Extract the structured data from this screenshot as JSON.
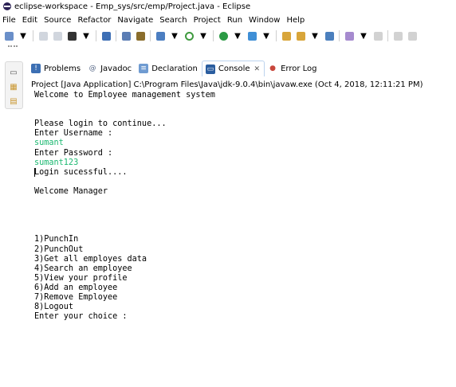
{
  "window": {
    "title": "eclipse-workspace - Emp_sys/src/emp/Project.java - Eclipse"
  },
  "menu": [
    "File",
    "Edit",
    "Source",
    "Refactor",
    "Navigate",
    "Search",
    "Project",
    "Run",
    "Window",
    "Help"
  ],
  "toolbar_icons": [
    {
      "name": "new-icon",
      "color": "#6a8fc9"
    },
    {
      "name": "save-icon",
      "color": "#9aa5b5"
    },
    {
      "name": "save-all-icon",
      "color": "#9aa5b5"
    },
    {
      "name": "console-icon",
      "color": "#333333"
    },
    {
      "name": "open-type-icon",
      "color": "#3e6fb5"
    },
    {
      "name": "toggle-breadcrumb-icon",
      "color": "#5b7db4"
    },
    {
      "name": "toggle-mark-occurrences-icon",
      "color": "#8a6d2c"
    },
    {
      "name": "skip-breakpoints-icon",
      "color": "#4c7ec1"
    },
    {
      "name": "debug-icon",
      "color": "#3f9a3f"
    },
    {
      "name": "run-icon",
      "color": "#2b9a44"
    },
    {
      "name": "run-external-tool-icon",
      "color": "#3f8fd6"
    },
    {
      "name": "new-java-project-icon",
      "color": "#d8a53a"
    },
    {
      "name": "new-package-icon",
      "color": "#d8a53a"
    },
    {
      "name": "new-class-icon",
      "color": "#4b7fbd"
    },
    {
      "name": "search-icon",
      "color": "#a68bcf"
    },
    {
      "name": "annotation-icon",
      "color": "#9c9c9c"
    },
    {
      "name": "show-whitespace-icon",
      "color": "#9c9c9c"
    },
    {
      "name": "pin-icon",
      "color": "#9c9c9c"
    }
  ],
  "left_strip": {
    "icons": [
      "minimize-icon",
      "package-explorer-icon",
      "outline-icon"
    ]
  },
  "tabs": [
    {
      "label": "Problems",
      "icon": "problems-icon",
      "active": false
    },
    {
      "label": "Javadoc",
      "icon": "javadoc-icon",
      "active": false
    },
    {
      "label": "Declaration",
      "icon": "declaration-icon",
      "active": false
    },
    {
      "label": "Console",
      "icon": "console-icon",
      "active": true,
      "close": "✕"
    },
    {
      "label": "Error Log",
      "icon": "error-log-icon",
      "active": false
    }
  ],
  "console": {
    "header": "Project [Java Application] C:\\Program Files\\Java\\jdk-9.0.4\\bin\\javaw.exe (Oct 4, 2018, 12:11:21 PM)",
    "input_color": "#1bb870",
    "lines": [
      {
        "text": "Welcome to Employee management system",
        "kind": "out"
      },
      {
        "text": "",
        "kind": "out"
      },
      {
        "text": "",
        "kind": "out"
      },
      {
        "text": "Please login to continue...",
        "kind": "out"
      },
      {
        "text": "Enter Username :",
        "kind": "out"
      },
      {
        "text": "sumant",
        "kind": "in"
      },
      {
        "text": "Enter Password :",
        "kind": "out"
      },
      {
        "text": "sumant123",
        "kind": "in"
      },
      {
        "text": "Login sucessful....",
        "kind": "out",
        "caret": true
      },
      {
        "text": "",
        "kind": "out"
      },
      {
        "text": "Welcome Manager",
        "kind": "out"
      },
      {
        "text": "",
        "kind": "out"
      },
      {
        "text": "",
        "kind": "out"
      },
      {
        "text": "",
        "kind": "out"
      },
      {
        "text": "",
        "kind": "out"
      },
      {
        "text": "1)PunchIn",
        "kind": "out"
      },
      {
        "text": "2)PunchOut",
        "kind": "out"
      },
      {
        "text": "3)Get all employes data",
        "kind": "out"
      },
      {
        "text": "4)Search an employee",
        "kind": "out"
      },
      {
        "text": "5)View your profile",
        "kind": "out"
      },
      {
        "text": "6)Add an employee",
        "kind": "out"
      },
      {
        "text": "7)Remove Employee",
        "kind": "out"
      },
      {
        "text": "8)Logout",
        "kind": "out"
      },
      {
        "text": "Enter your choice :",
        "kind": "out"
      }
    ]
  }
}
